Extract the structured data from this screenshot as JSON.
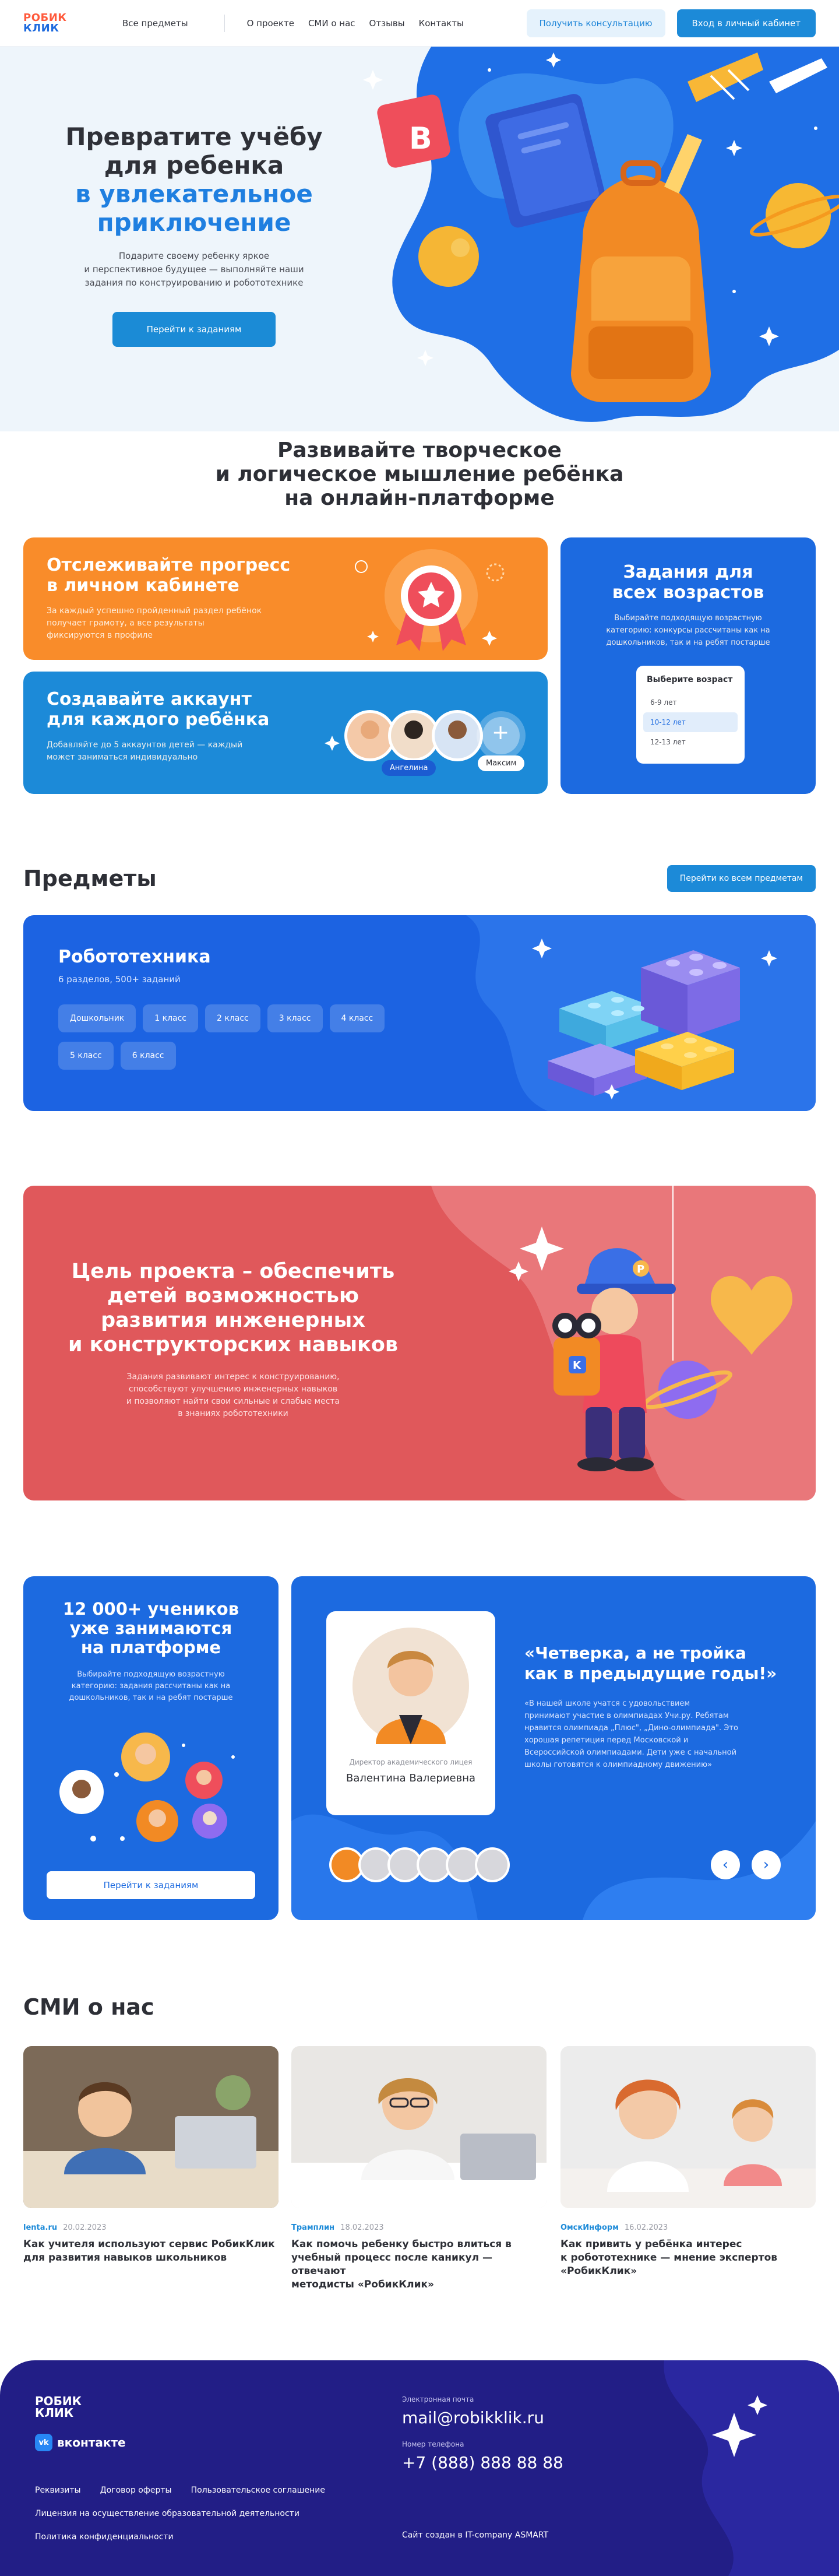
{
  "header": {
    "logo_line1": "РОБИК",
    "logo_line2": "КЛИК",
    "nav_all_subjects": "Все предметы",
    "nav_items": [
      "О проекте",
      "СМИ о нас",
      "Отзывы",
      "Контакты"
    ],
    "btn_consult": "Получить консультацию",
    "btn_login": "Вход в личный кабинет"
  },
  "hero": {
    "title_line1": "Превратите учёбу",
    "title_line2": "для ребенка",
    "title_accent1": "в увлекательное",
    "title_accent2": "приключение",
    "sub_line1": "Подарите своему ребенку яркое",
    "sub_line2": "и перспективное будущее — выполняйте наши",
    "sub_line3": "задания по конструированию и робототехнике",
    "cta": "Перейти к заданиям",
    "book_letter": "B"
  },
  "features": {
    "title_line1": "Развивайте творческое",
    "title_line2": "и логическое мышление ребёнка",
    "title_line3": "на онлайн-платформе",
    "progress": {
      "title_line1": "Отслеживайте прогресс",
      "title_line2": "в личном кабинете",
      "text_line1": "За каждый успешно пройденный раздел ребёнок",
      "text_line2": "получает грамоту, а все результаты",
      "text_line3": "фиксируются в профиле"
    },
    "account": {
      "title_line1": "Создавайте аккаунт",
      "title_line2": "для каждого ребёнка",
      "text_line1": "Добавляйте до 5 аккаунтов детей — каждый",
      "text_line2": "может заниматься индивидуально",
      "name1": "Ангелина",
      "name2": "Максим",
      "plus": "+"
    },
    "ages": {
      "title_line1": "Задания для",
      "title_line2": "всех возрастов",
      "text_line1": "Выбирайте подходящую возрастную",
      "text_line2": "категорию: конкурсы рассчитаны как на",
      "text_line3": "дошкольников, так и на ребят постарше",
      "select_label": "Выберите возраст",
      "options": [
        "6-9 лет",
        "10-12 лет",
        "12-13 лет"
      ]
    }
  },
  "subjects": {
    "title": "Предметы",
    "btn_all": "Перейти ко всем предметам",
    "card_title": "Робототехника",
    "card_meta": "6 разделов, 500+ заданий",
    "chips": [
      "Дошкольник",
      "1 класс",
      "2 класс",
      "3 класс",
      "4 класс",
      "5 класс",
      "6 класс"
    ]
  },
  "goal": {
    "title_line1": "Цель проекта – обеспечить",
    "title_line2": "детей возможностью",
    "title_line3": "развития инженерных",
    "title_line4": "и конструкторских навыков",
    "text_line1": "Задания развивают интерес к конструированию,",
    "text_line2": "способствуют улучшению инженерных навыков",
    "text_line3": "и позволяют найти свои сильные и слабые места",
    "text_line4": "в знаниях робототехники",
    "cap_letter": "P",
    "robot_letter": "K"
  },
  "stats": {
    "title_line1": "12 000+ учеников",
    "title_line2": "уже занимаются",
    "title_line3": "на платформе",
    "text_line1": "Выбирайте подходящую возрастную",
    "text_line2": "категорию: задания рассчитаны как на",
    "text_line3": "дошкольников, так и на ребят постарше",
    "cta": "Перейти к заданиям"
  },
  "review": {
    "person_role": "Директор академического лицея",
    "person_name": "Валентина Валериевна",
    "quote_title_line1": "«Четверка, а не тройка",
    "quote_title_line2": "как в предыдущие годы!»",
    "quote_line1": "«В нашей школе учатся с удовольствием",
    "quote_line2": "принимают участие в олимпиадах Учи.ру. Ребятам",
    "quote_line3": "нравится олимпиада „Плюс\", „Дино-олимпиада\". Это",
    "quote_line4": "хорошая репетиция перед Московской и",
    "quote_line5": "Всероссийской олимпиадами. Дети уже с начальной",
    "quote_line6": "школы готовятся к олимпиадному движению»",
    "prev": "‹",
    "next": "›"
  },
  "press": {
    "title": "СМИ о нас",
    "items": [
      {
        "source": "lenta.ru",
        "date": "20.02.2023",
        "title_line1": "Как учителя используют сервис РобикКлик",
        "title_line2": "для развития навыков школьников",
        "title_line3": ""
      },
      {
        "source": "Трамплин",
        "date": "18.02.2023",
        "title_line1": "Как помочь ребенку быстро влиться в",
        "title_line2": "учебный процесс после каникул — отвечают",
        "title_line3": "методисты «РобикКлик»"
      },
      {
        "source": "ОмскИнформ",
        "date": "16.02.2023",
        "title_line1": "Как привить у ребёнка интерес",
        "title_line2": "к робототехнике — мнение экспертов",
        "title_line3": "«РобикКлик»"
      }
    ]
  },
  "footer": {
    "logo_line1": "РОБИК",
    "logo_line2": "КЛИК",
    "vk": "вконтакте",
    "vk_badge": "vk",
    "links_row1": [
      "Реквизиты",
      "Договор оферты",
      "Пользовательское соглашение"
    ],
    "link_license": "Лицензия на осуществление образовательной деятельности",
    "link_privacy": "Политика конфиденциальности",
    "email_label": "Электронная почта",
    "email": "mail@robikklik.ru",
    "phone_label": "Номер телефона",
    "phone": "+7 (888) 888 88 88",
    "made_by": "Сайт создан в IT-company ASMART"
  },
  "colors": {
    "brand_blue": "#1c6ae0",
    "accent_blue": "#1c8ad8",
    "orange": "#f98c2a",
    "goal_red": "#e0585b",
    "footer": "#221e86",
    "logo_red": "#ff5a3c"
  }
}
